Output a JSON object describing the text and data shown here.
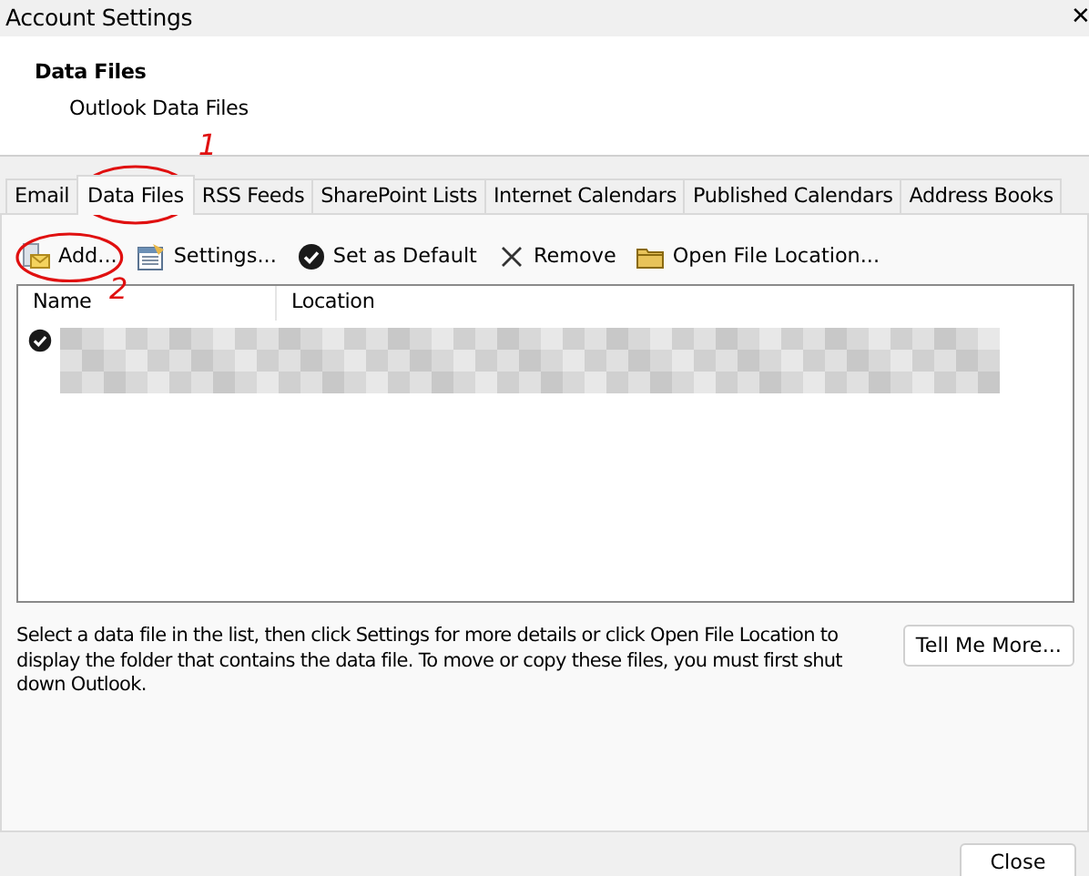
{
  "window": {
    "title": "Account Settings",
    "close_glyph": "✕"
  },
  "header": {
    "title": "Data Files",
    "subtitle": "Outlook Data Files"
  },
  "tabs": [
    {
      "label": "Email",
      "selected": false
    },
    {
      "label": "Data Files",
      "selected": true,
      "annotation": "1"
    },
    {
      "label": "RSS Feeds",
      "selected": false
    },
    {
      "label": "SharePoint Lists",
      "selected": false
    },
    {
      "label": "Internet Calendars",
      "selected": false
    },
    {
      "label": "Published Calendars",
      "selected": false
    },
    {
      "label": "Address Books",
      "selected": false
    }
  ],
  "toolbar": [
    {
      "kind": "add",
      "label": "Add...",
      "annotation": "2"
    },
    {
      "kind": "settings",
      "label": "Settings..."
    },
    {
      "kind": "default",
      "label": "Set as Default"
    },
    {
      "kind": "remove",
      "label": "Remove"
    },
    {
      "kind": "folder",
      "label": "Open File Location..."
    }
  ],
  "table": {
    "columns": [
      "Name",
      "Location"
    ],
    "rows": [
      {
        "default": true,
        "redacted": true
      }
    ]
  },
  "description": "Select a data file in the list, then click Settings for more details or click Open File Location to display the folder that contains the data file. To move or copy these files, you must first shut down Outlook.",
  "tell_me_more": "Tell Me More...",
  "close_button": "Close"
}
